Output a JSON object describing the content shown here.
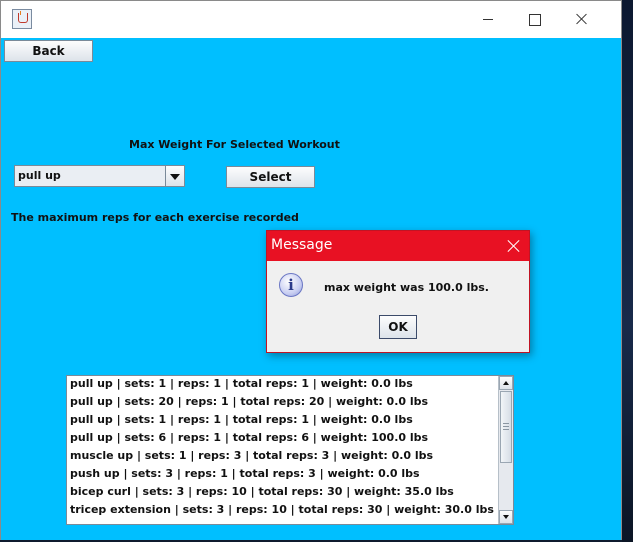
{
  "window": {
    "title": "",
    "icon": "java-icon"
  },
  "toolbar": {
    "back_label": "Back"
  },
  "workout": {
    "heading": "Max Weight For Selected Workout",
    "selected": "pull up",
    "select_label": "Select",
    "info_text": "The maximum reps for each exercise recorded"
  },
  "list": {
    "rows": [
      "pull up | sets: 1 | reps: 1 | total reps: 1 | weight: 0.0 lbs",
      "pull up | sets: 20 | reps: 1 | total reps: 20 | weight: 0.0 lbs",
      "pull up | sets: 1 | reps: 1 | total reps: 1 | weight: 0.0 lbs",
      "pull up | sets: 6 | reps: 1 | total reps: 6 | weight: 100.0 lbs",
      "muscle up | sets: 1 | reps: 3 | total reps: 3 | weight: 0.0 lbs",
      "push up | sets: 3 | reps: 1 | total reps: 3 | weight: 0.0 lbs",
      "bicep curl | sets: 3 | reps: 10 | total reps: 30 | weight: 35.0 lbs",
      "tricep extension | sets: 3 | reps: 10 | total reps: 30 | weight: 30.0 lbs"
    ]
  },
  "dialog": {
    "title": "Message",
    "message": "max weight was 100.0 lbs.",
    "ok_label": "OK",
    "icon": "info-icon"
  },
  "colors": {
    "background": "#00bfff",
    "dialog_title": "#e81123"
  }
}
